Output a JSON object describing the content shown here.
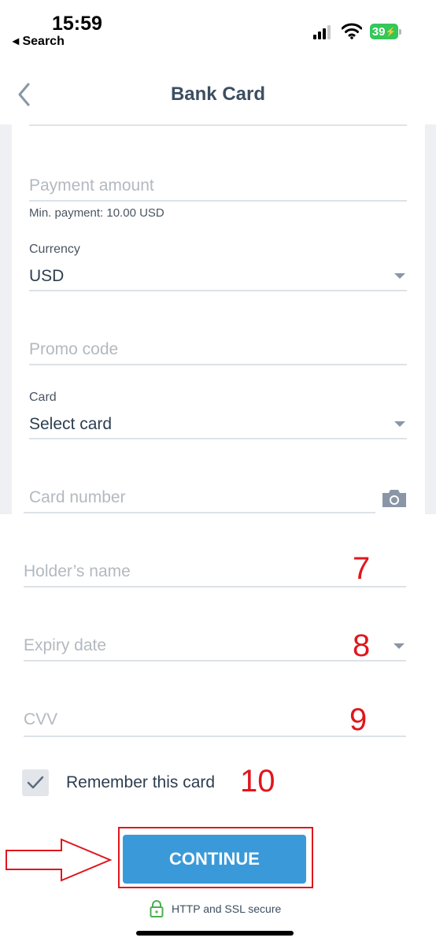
{
  "status_bar": {
    "time": "15:59",
    "back_app": "◂ Search",
    "battery": "39"
  },
  "nav": {
    "title": "Bank Card"
  },
  "form": {
    "payment_amount": {
      "placeholder": "Payment amount",
      "hint": "Min. payment: 10.00 USD"
    },
    "currency": {
      "label": "Currency",
      "value": "USD"
    },
    "promo_code": {
      "placeholder": "Promo code"
    },
    "card": {
      "label": "Card",
      "value": "Select card"
    },
    "card_number": {
      "placeholder": "Card number"
    },
    "holder_name": {
      "placeholder": "Holder’s name"
    },
    "expiry_date": {
      "placeholder": "Expiry date"
    },
    "cvv": {
      "placeholder": "CVV"
    },
    "remember": {
      "label": "Remember this card",
      "checked": true
    }
  },
  "annotations": {
    "holder": "7",
    "expiry": "8",
    "cvv": "9",
    "remember": "10"
  },
  "actions": {
    "continue_label": "CONTINUE"
  },
  "footer": {
    "secure_text": "HTTP and SSL secure"
  },
  "colors": {
    "accent": "#3a9ad9",
    "annotation_red": "#e0161c",
    "text": "#2d3e50",
    "placeholder": "#b3b9c0",
    "secure_green": "#4caf50"
  },
  "icons": [
    "back-chevron-icon",
    "dropdown-arrow-icon",
    "camera-icon",
    "checkmark-icon",
    "lock-icon",
    "signal-icon",
    "wifi-icon",
    "battery-icon"
  ]
}
